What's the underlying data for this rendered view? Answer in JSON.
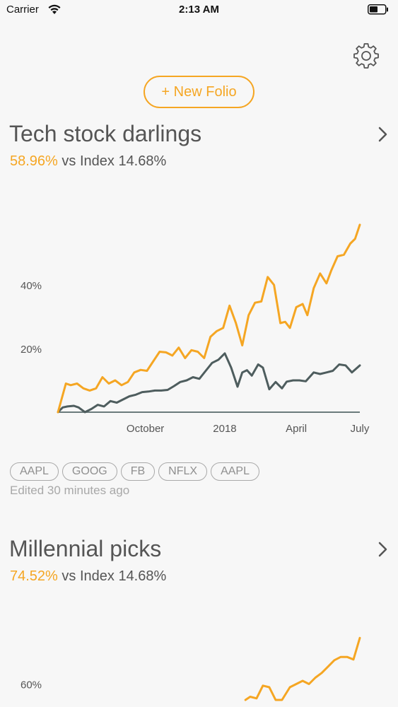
{
  "status_bar": {
    "carrier": "Carrier",
    "time": "2:13 AM"
  },
  "new_folio_label": "+ New Folio",
  "icons": {
    "settings": "gear-icon",
    "chevron": "chevron-right-icon",
    "wifi": "wifi-icon",
    "battery": "battery-icon"
  },
  "colors": {
    "accent": "#f5a623",
    "index_line": "#4e5d5e",
    "text": "#555555"
  },
  "folios": [
    {
      "title": "Tech stock darlings",
      "perf_value": "58.96%",
      "perf_rest": " vs Index 14.68%",
      "tags": [
        "AAPL",
        "GOOG",
        "FB",
        "NFLX",
        "AAPL"
      ],
      "edited": "Edited 30 minutes ago"
    },
    {
      "title": "Millennial picks",
      "perf_value": "74.52%",
      "perf_rest": " vs Index 14.68%"
    }
  ],
  "chart_data": [
    {
      "type": "line",
      "x_tick_labels": [
        "October",
        "2018",
        "April",
        "July"
      ],
      "x_tick_positions": [
        5.5,
        10.5,
        15,
        19
      ],
      "y_tick_labels": [
        "20%",
        "40%"
      ],
      "y_tick_values": [
        20,
        40
      ],
      "ylim": [
        0,
        60
      ],
      "xlim": [
        0,
        19
      ],
      "series": [
        {
          "name": "",
          "color": "#f5a623",
          "x": [
            0,
            0.5,
            0.8,
            1.2,
            1.6,
            2.0,
            2.4,
            2.8,
            3.2,
            3.6,
            4.0,
            4.4,
            4.8,
            5.2,
            5.6,
            6.0,
            6.4,
            6.8,
            7.2,
            7.6,
            8.0,
            8.4,
            8.8,
            9.2,
            9.6,
            10.0,
            10.4,
            10.8,
            11.2,
            11.6,
            12.0,
            12.4,
            12.8,
            13.2,
            13.6,
            14.0,
            14.3,
            14.6,
            15.0,
            15.4,
            15.7,
            16.1,
            16.5,
            16.9,
            17.2,
            17.6,
            18.0,
            18.4,
            18.7,
            19.0
          ],
          "y": [
            0,
            9,
            8.5,
            9,
            7.5,
            6.8,
            7.5,
            11,
            9,
            10,
            8.5,
            9.5,
            12.5,
            13.3,
            13,
            16,
            19,
            18.8,
            17.8,
            20.3,
            17,
            19.5,
            19,
            17,
            23.7,
            25.5,
            26.5,
            33.5,
            28,
            21,
            30.5,
            34.4,
            34.8,
            42.5,
            40,
            28,
            28.4,
            26.5,
            33,
            34,
            30.5,
            39,
            43.6,
            40.5,
            44.5,
            49,
            49.5,
            53,
            54.5,
            58.9
          ]
        },
        {
          "name": "",
          "color": "#4e5d5e",
          "x": [
            0,
            0.3,
            0.6,
            1.0,
            1.3,
            1.7,
            2.1,
            2.5,
            2.9,
            3.3,
            3.7,
            4.1,
            4.5,
            4.9,
            5.3,
            5.7,
            6.1,
            6.5,
            6.9,
            7.3,
            7.7,
            8.1,
            8.5,
            8.9,
            9.3,
            9.7,
            10.1,
            10.5,
            10.9,
            11.3,
            11.6,
            11.9,
            12.2,
            12.6,
            12.9,
            13.3,
            13.7,
            14.1,
            14.4,
            14.8,
            15.2,
            15.6,
            16.1,
            16.5,
            16.9,
            17.3,
            17.7,
            18.1,
            18.5,
            19.0
          ],
          "y": [
            0,
            1.5,
            1.8,
            2,
            1.5,
            0,
            1,
            2.3,
            1.8,
            3.5,
            3,
            4,
            5,
            5.5,
            6.3,
            6.5,
            6.8,
            6.8,
            7,
            8.2,
            9.5,
            10,
            11,
            10.5,
            13,
            15.5,
            16.5,
            18.5,
            14,
            8,
            12.5,
            13.2,
            11.5,
            15,
            14,
            7.2,
            9.5,
            7.5,
            9.6,
            10,
            10,
            9.7,
            12.5,
            12,
            12.5,
            13,
            15,
            14.7,
            12.5,
            14.68
          ]
        }
      ]
    },
    {
      "type": "line",
      "y_tick_labels": [
        "60%"
      ],
      "y_tick_values": [
        60
      ],
      "ylim": [
        55,
        75
      ],
      "xlim": [
        0,
        19
      ],
      "series": [
        {
          "name": "",
          "color": "#f5a623",
          "x": [
            11.8,
            12.1,
            12.5,
            12.9,
            13.3,
            13.7,
            14.1,
            14.6,
            15.0,
            15.4,
            15.8,
            16.2,
            16.6,
            17.0,
            17.4,
            17.8,
            18.2,
            18.6,
            19.0
          ],
          "y": [
            55,
            56,
            55.5,
            59.5,
            59,
            55,
            55,
            59,
            60,
            61,
            60,
            62,
            63.5,
            65.5,
            67.5,
            68.5,
            68.5,
            67.7,
            74.5
          ]
        }
      ]
    }
  ]
}
